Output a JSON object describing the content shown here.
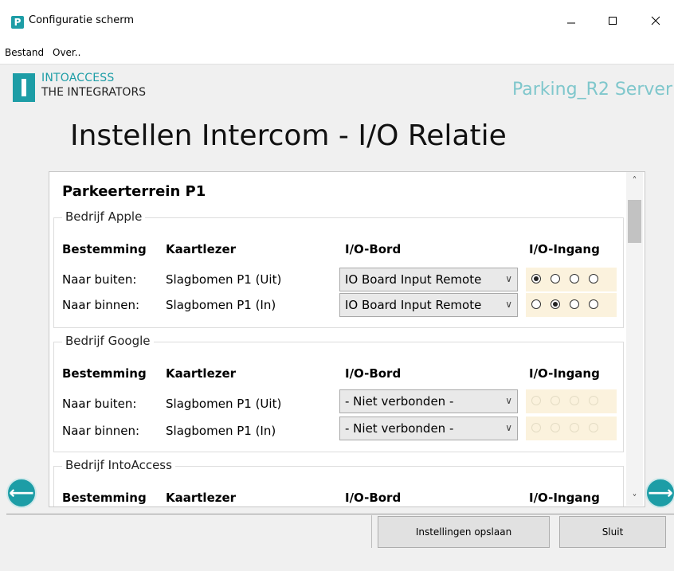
{
  "window": {
    "title": "Configuratie scherm",
    "app_icon_letter": "P"
  },
  "menu": {
    "items": [
      "Bestand",
      "Over.."
    ]
  },
  "brand": {
    "line1": "INTOACCESS",
    "line2": "THE INTEGRATORS",
    "server": "Parking_R2 Server"
  },
  "page": {
    "title": "Instellen Intercom - I/O Relatie"
  },
  "terrain": {
    "title": "Parkeerterrein P1"
  },
  "headers": {
    "destination": "Bestemming",
    "reader": "Kaartlezer",
    "board": "I/O-Bord",
    "input": "I/O-Ingang"
  },
  "groups": [
    {
      "name": "Bedrijf Apple",
      "rows": [
        {
          "destination": "Naar buiten:",
          "reader": "Slagbomen P1 (Uit)",
          "board": "IO Board Input Remote",
          "selected_input": 1,
          "enabled": true
        },
        {
          "destination": "Naar binnen:",
          "reader": "Slagbomen P1 (In)",
          "board": "IO Board Input Remote",
          "selected_input": 2,
          "enabled": true
        }
      ]
    },
    {
      "name": "Bedrijf Google",
      "rows": [
        {
          "destination": "Naar buiten:",
          "reader": "Slagbomen P1 (Uit)",
          "board": "- Niet verbonden -",
          "selected_input": 0,
          "enabled": false
        },
        {
          "destination": "Naar binnen:",
          "reader": "Slagbomen P1 (In)",
          "board": "- Niet verbonden -",
          "selected_input": 0,
          "enabled": false
        }
      ]
    },
    {
      "name": "Bedrijf IntoAccess",
      "rows": []
    }
  ],
  "buttons": {
    "save": "Instellingen opslaan",
    "close": "Sluit"
  },
  "colors": {
    "accent": "#1d9da6",
    "radio_bg": "#fbf2dd"
  }
}
